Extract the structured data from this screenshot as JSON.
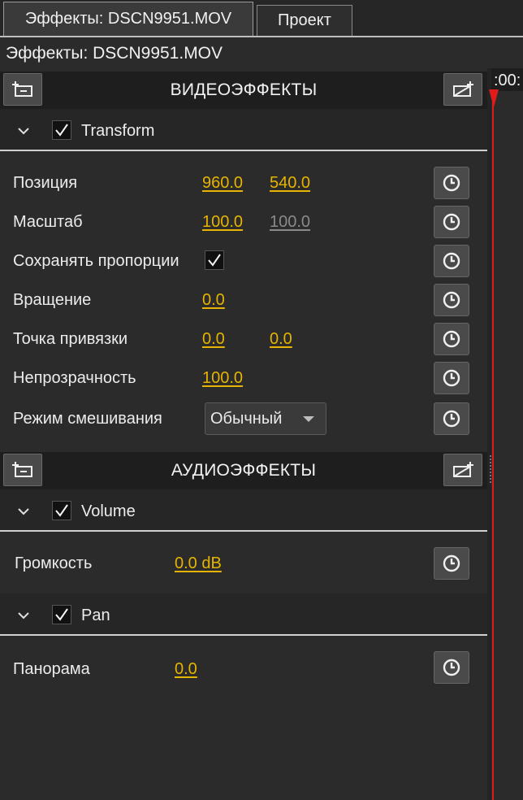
{
  "tabs": [
    {
      "label": "Эффекты: DSCN9951.MOV",
      "active": true
    },
    {
      "label": "Проект",
      "active": false
    }
  ],
  "panel_title": "Эффекты: DSCN9951.MOV",
  "timeline_time": ":00:",
  "video": {
    "title": "ВИДЕОЭФФЕКТЫ",
    "effect": {
      "name": "Transform",
      "checked": true
    },
    "props": {
      "position": {
        "label": "Позиция",
        "x": "960.0",
        "y": "540.0"
      },
      "scale": {
        "label": "Масштаб",
        "x": "100.0",
        "y": "100.0"
      },
      "keep_ratio": {
        "label": "Сохранять пропорции",
        "checked": true
      },
      "rotation": {
        "label": "Вращение",
        "value": "0.0"
      },
      "anchor": {
        "label": "Точка привязки",
        "x": "0.0",
        "y": "0.0"
      },
      "opacity": {
        "label": "Непрозрачность",
        "value": "100.0"
      },
      "blend": {
        "label": "Режим смешивания",
        "value": "Обычный"
      }
    }
  },
  "audio": {
    "title": "АУДИОЭФФЕКТЫ",
    "volume": {
      "name": "Volume",
      "checked": true,
      "label": "Громкость",
      "value": "0.0 dB"
    },
    "pan": {
      "name": "Pan",
      "checked": true,
      "label": "Панорама",
      "value": "0.0"
    }
  },
  "colors": {
    "accent": "#e6b400",
    "playhead": "#e11b1b",
    "background": "#2b2b2b"
  }
}
